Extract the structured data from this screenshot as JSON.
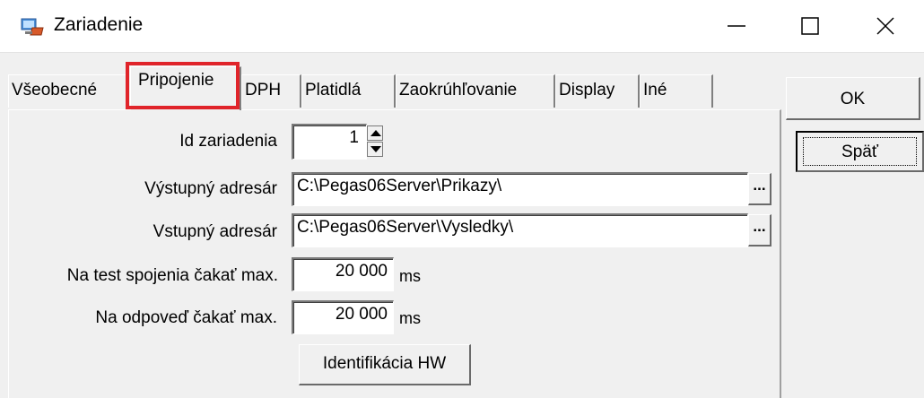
{
  "window": {
    "title": "Zariadenie",
    "icon": "device-computer-icon",
    "controls": {
      "minimize": "minimize-icon",
      "maximize": "maximize-icon",
      "close": "close-icon"
    }
  },
  "tabs": [
    {
      "label": "Všeobecné",
      "active": false
    },
    {
      "label": "Pripojenie",
      "active": true
    },
    {
      "label": "DPH",
      "active": false
    },
    {
      "label": "Platidlá",
      "active": false
    },
    {
      "label": "Zaokrúhľovanie",
      "active": false
    },
    {
      "label": "Display",
      "active": false
    },
    {
      "label": "Iné",
      "active": false
    }
  ],
  "form": {
    "device_id": {
      "label": "Id zariadenia",
      "value": "1"
    },
    "output_dir": {
      "label": "Výstupný adresár",
      "value": "C:\\Pegas06Server\\Prikazy\\"
    },
    "input_dir": {
      "label": "Vstupný adresár",
      "value": "C:\\Pegas06Server\\Vysledky\\"
    },
    "connection_test_wait": {
      "label": "Na test spojenia čakať max.",
      "value": "20 000",
      "unit": "ms"
    },
    "response_wait": {
      "label": "Na odpoveď čakať max.",
      "value": "20 000",
      "unit": "ms"
    },
    "browse_label": "...",
    "identify_hw_label": "Identifikácia HW"
  },
  "buttons": {
    "ok": "OK",
    "back": "Späť"
  },
  "colors": {
    "highlight": "#e0242a",
    "window_bg": "#f0f0f0"
  }
}
